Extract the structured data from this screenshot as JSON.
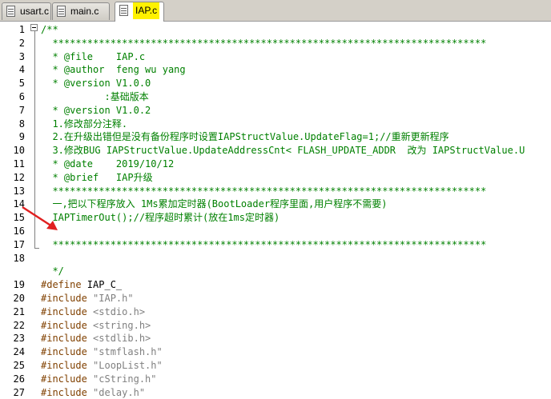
{
  "tabs": [
    {
      "label": "usart.c",
      "active": false
    },
    {
      "label": "main.c",
      "active": false
    },
    {
      "label": "IAP.c",
      "active": true
    }
  ],
  "lines": [
    {
      "n": "1",
      "text": "/**"
    },
    {
      "n": "2",
      "text": "  ***************************************************************************"
    },
    {
      "n": "3",
      "text": "  * @file    IAP.c"
    },
    {
      "n": "4",
      "text": "  * @author  feng wu yang"
    },
    {
      "n": "5",
      "text": "  * @version V1.0.0"
    },
    {
      "n": "6",
      "text": "           :基础版本"
    },
    {
      "n": "7",
      "text": "  * @version V1.0.2"
    },
    {
      "n": "8",
      "text": "  1.修改部分注释."
    },
    {
      "n": "9",
      "text": "  2.在升级出错但是没有备份程序时设置IAPStructValue.UpdateFlag=1;//重新更新程序"
    },
    {
      "n": "10",
      "text": "  3.修改BUG IAPStructValue.UpdateAddressCnt< FLASH_UPDATE_ADDR  改为 IAPStructValue.U"
    },
    {
      "n": "11",
      "text": "  * @date    2019/10/12"
    },
    {
      "n": "12",
      "text": "  * @brief   IAP升级"
    },
    {
      "n": "13",
      "text": "  ***************************************************************************"
    },
    {
      "n": "14",
      "text": "  一,把以下程序放入 1Ms累加定时器(BootLoader程序里面,用户程序不需要)"
    },
    {
      "n": "15",
      "text": "  IAPTimerOut();//程序超时累计(放在1ms定时器)"
    },
    {
      "n": "16",
      "text": ""
    },
    {
      "n": "17",
      "text": "  ***************************************************************************"
    },
    {
      "n": "18",
      "text": ""
    },
    {
      "n": "",
      "text": "  */"
    }
  ],
  "code_lines": [
    {
      "n": "19",
      "pp": "#define",
      "rest": " IAP_C_",
      "str": ""
    },
    {
      "n": "20",
      "pp": "#include",
      "rest": " ",
      "str": "\"IAP.h\""
    },
    {
      "n": "21",
      "pp": "#include",
      "rest": " ",
      "str": "<stdio.h>"
    },
    {
      "n": "22",
      "pp": "#include",
      "rest": " ",
      "str": "<string.h>"
    },
    {
      "n": "23",
      "pp": "#include",
      "rest": " ",
      "str": "<stdlib.h>"
    },
    {
      "n": "24",
      "pp": "#include",
      "rest": " ",
      "str": "\"stmflash.h\""
    },
    {
      "n": "25",
      "pp": "#include",
      "rest": " ",
      "str": "\"LoopList.h\""
    },
    {
      "n": "26",
      "pp": "#include",
      "rest": " ",
      "str": "\"cString.h\""
    },
    {
      "n": "27",
      "pp": "#include",
      "rest": " ",
      "str": "\"delay.h\""
    }
  ],
  "colors": {
    "comment": "#008000",
    "preprocessor": "#804000",
    "string": "#808080",
    "highlight": "#fff200",
    "arrow": "#e02020"
  }
}
